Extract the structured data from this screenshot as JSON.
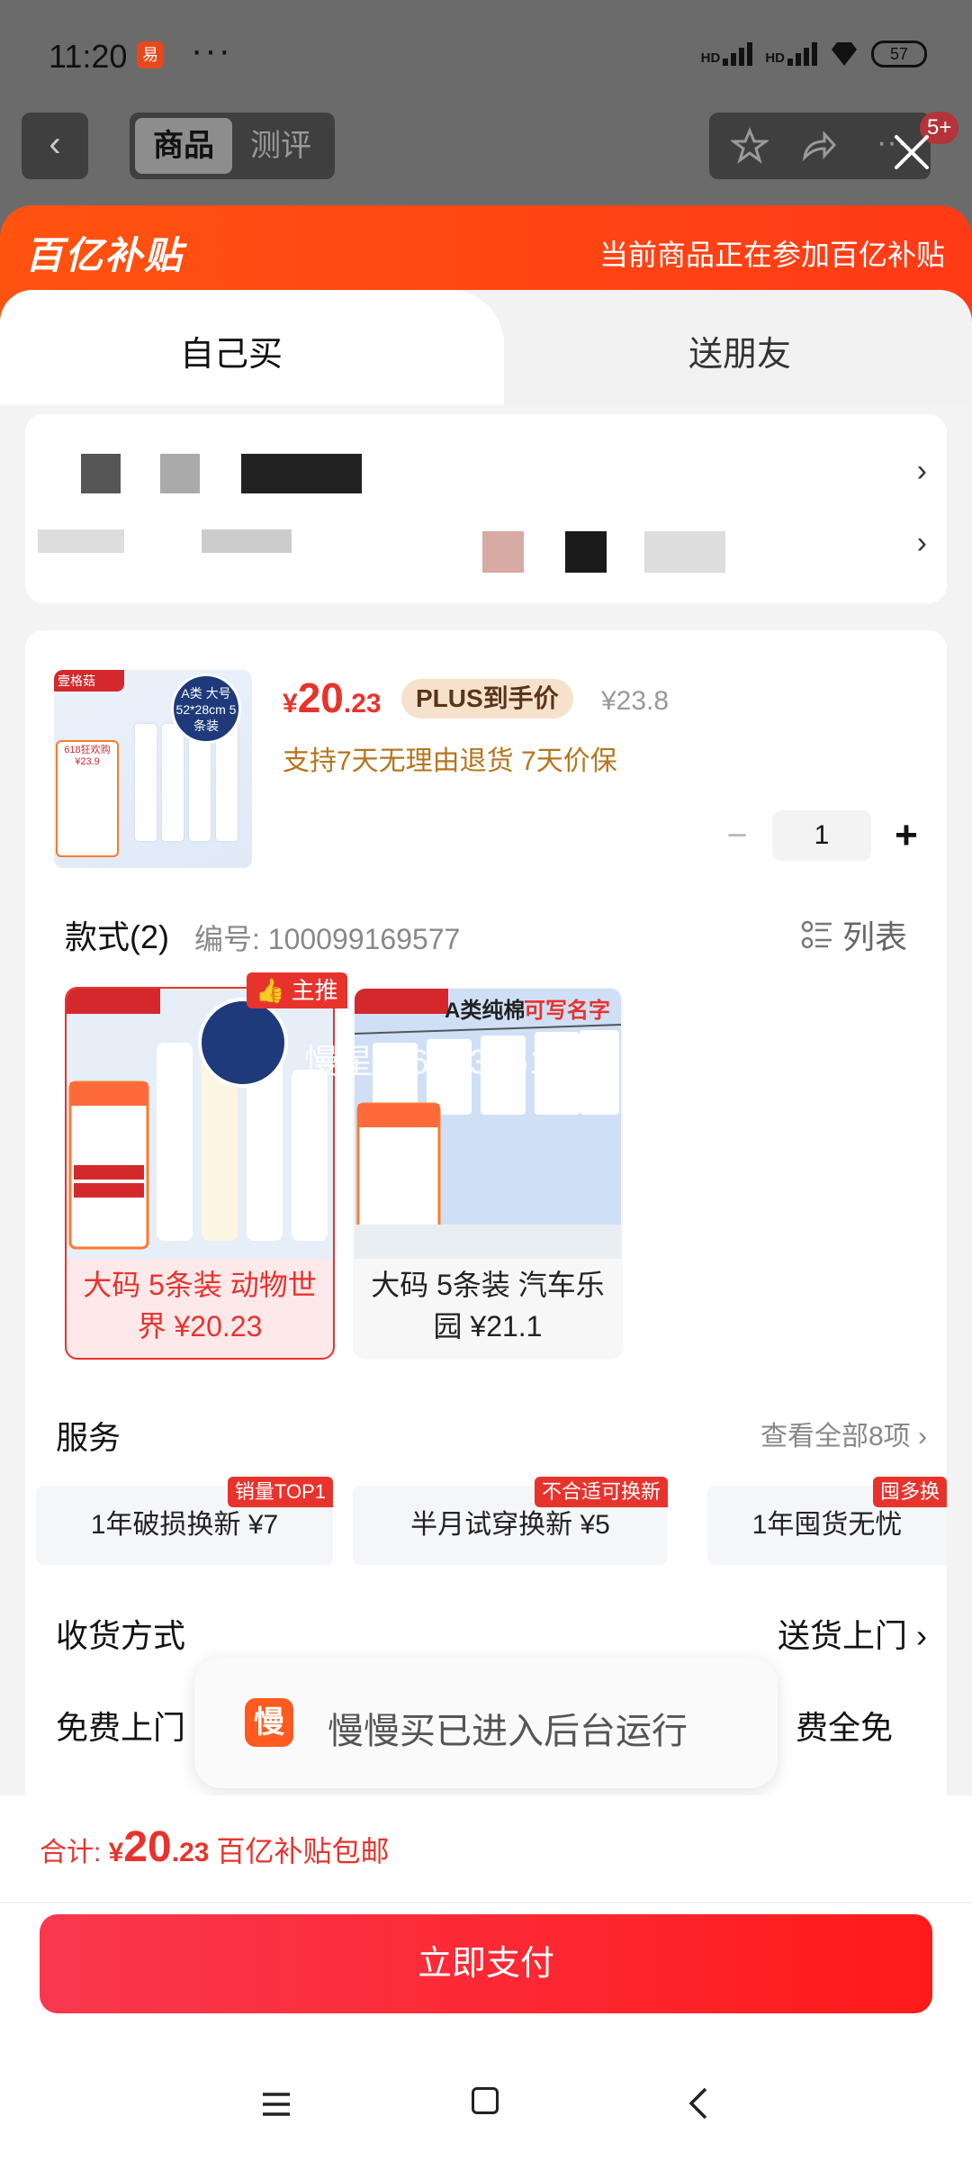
{
  "status_bar": {
    "time": "11:20",
    "app_badge": "易",
    "dots": "···",
    "signal1": "HD",
    "signal2": "HD",
    "battery": "57"
  },
  "top_nav": {
    "tabs": [
      "商品",
      "测评"
    ],
    "badge": "5+"
  },
  "banner": {
    "brand": "百亿补贴",
    "note": "当前商品正在参加百亿补贴"
  },
  "mode_tabs": {
    "self": "自己买",
    "friend": "送朋友"
  },
  "product": {
    "price_currency": "¥",
    "price_int": "20",
    "price_dec": ".23",
    "plus_label": "PLUS到手价",
    "original_price": "¥23.8",
    "support": "支持7天无理由退货  7天价保",
    "quantity": "1",
    "thumb_tag": "壹格菇",
    "thumb_badge": "A类 大号52*28cm 5条装",
    "thumb_promo": "618狂欢购 ¥23.9"
  },
  "styles": {
    "title": "款式(2)",
    "code": "编号: 100099169577",
    "list_label": "列表",
    "main_tag": "主推",
    "watermark": "慢星人6973761R1",
    "variants": [
      {
        "name": "大码 5条装 动物世界 ¥20.23",
        "selected": true
      },
      {
        "name": "大码 5条装 汽车乐园 ¥21.1",
        "selected": false,
        "img_title": "A类纯棉",
        "img_subtitle": "可写名字"
      }
    ]
  },
  "services": {
    "title": "服务",
    "view_all": "查看全部8项",
    "items": [
      {
        "label": "1年破损换新  ¥7",
        "tag": "销量TOP1"
      },
      {
        "label": "半月试穿换新  ¥5",
        "tag": "不合适可换新"
      },
      {
        "label": "1年囤货无忧",
        "tag": "囤多换"
      }
    ]
  },
  "shipping": {
    "title": "收货方式",
    "value": "送货上门",
    "free_left": "免费上门",
    "free_right": "费全免"
  },
  "toast": {
    "icon": "慢",
    "text": "慢慢买已进入后台运行"
  },
  "footer": {
    "total_label": "合计: ",
    "total_currency": "¥",
    "total_int": "20",
    "total_dec": ".23",
    "total_note": "百亿补贴包邮",
    "pay_label": "立即支付"
  },
  "colors": {
    "accent": "#e8332d",
    "banner": "#ff4a12",
    "gold": "#b5751c"
  }
}
